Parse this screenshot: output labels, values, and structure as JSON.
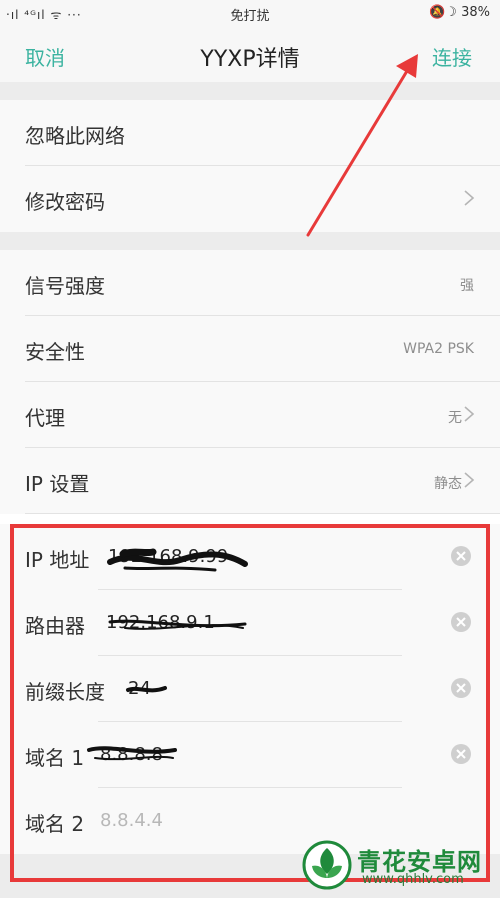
{
  "status_bar": {
    "signal": "‧ıl ⁴ᴳıl ᯤ ···",
    "mode": "免打扰",
    "indicators": "🔕☽ 38%",
    "battery_icon": "battery-icon"
  },
  "nav": {
    "cancel": "取消",
    "title": "YYXP详情",
    "connect": "连接"
  },
  "section1": [
    {
      "label": "忽略此网络",
      "value": "",
      "chevron": false
    },
    {
      "label": "修改密码",
      "value": "",
      "chevron": true
    }
  ],
  "section2": [
    {
      "label": "信号强度",
      "value": "强",
      "chevron": false
    },
    {
      "label": "安全性",
      "value": "WPA2 PSK",
      "chevron": false
    },
    {
      "label": "代理",
      "value": "无",
      "chevron": true
    },
    {
      "label": "IP 设置",
      "value": "静态",
      "chevron": true
    }
  ],
  "fields": [
    {
      "label": "IP 地址",
      "value": "192.168.9.99",
      "placeholder": false
    },
    {
      "label": "路由器",
      "value": "192.168.9.1",
      "placeholder": false
    },
    {
      "label": "前缀长度",
      "value": "24",
      "placeholder": false
    },
    {
      "label": "域名 1",
      "value": "8.8.8.8",
      "placeholder": false
    },
    {
      "label": "域名 2",
      "value": "8.8.4.4",
      "placeholder": true
    }
  ],
  "watermark": {
    "title": "青花安卓网",
    "url": "www.qhhlv.com"
  },
  "colors": {
    "accent": "#3bb3a0",
    "annotation": "#e83a3a",
    "watermark": "#1f8a3b"
  }
}
